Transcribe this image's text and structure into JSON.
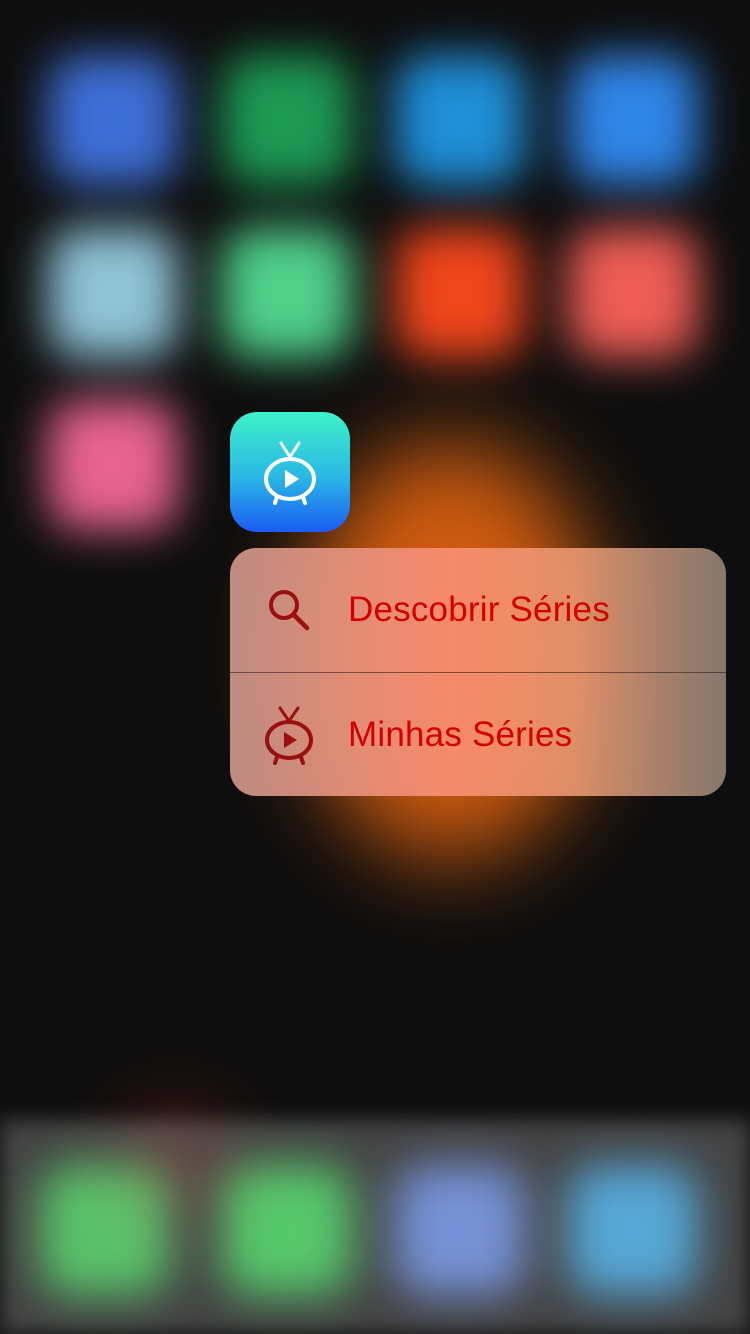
{
  "app": {
    "name": "TV series app",
    "icon": "tv-play-icon",
    "icon_gradient": [
      "#3ef2c8",
      "#2ab6e6",
      "#1a5cf2"
    ]
  },
  "quick_actions": [
    {
      "label": "Descobrir Séries",
      "icon": "search-icon"
    },
    {
      "label": "Minhas Séries",
      "icon": "tv-play-icon"
    }
  ],
  "colors": {
    "action_text": "#d40000",
    "action_icon": "#9a0f0f",
    "background": "#0e0e0e"
  }
}
